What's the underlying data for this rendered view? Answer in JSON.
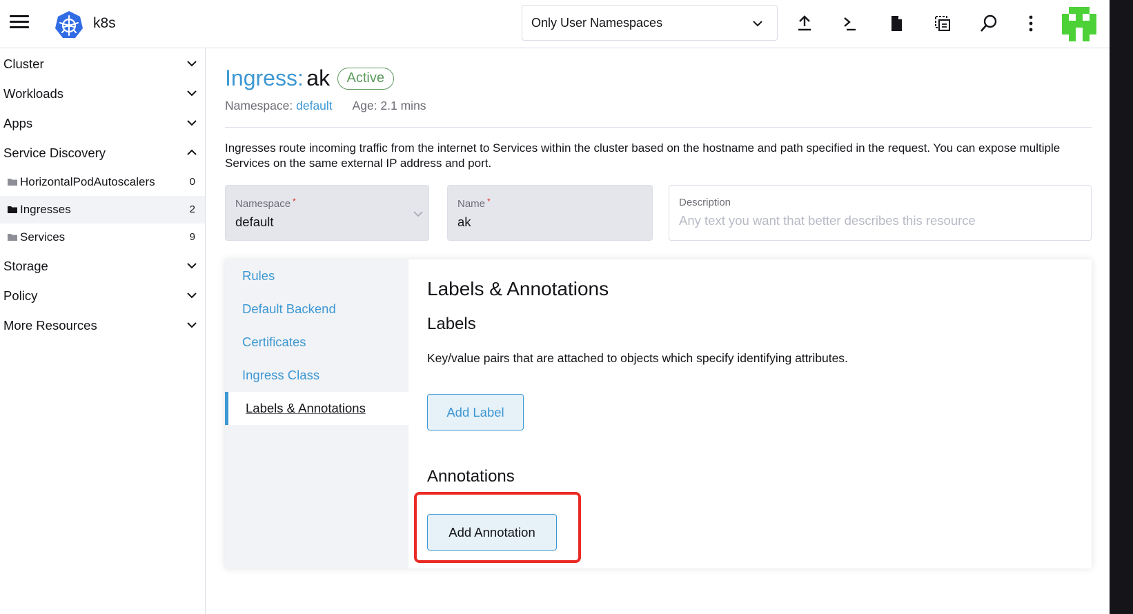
{
  "header": {
    "cluster_name": "k8s",
    "namespace_filter": "Only User Namespaces",
    "icons": [
      "upload-icon",
      "terminal-icon",
      "file-icon",
      "copy-kubeconfig-icon",
      "search-icon",
      "more-vertical-icon"
    ]
  },
  "sidebar": {
    "groups": [
      {
        "label": "Cluster",
        "expanded": false
      },
      {
        "label": "Workloads",
        "expanded": false
      },
      {
        "label": "Apps",
        "expanded": false
      },
      {
        "label": "Service Discovery",
        "expanded": true
      },
      {
        "label": "Storage",
        "expanded": false
      },
      {
        "label": "Policy",
        "expanded": false
      },
      {
        "label": "More Resources",
        "expanded": false
      }
    ],
    "children": [
      {
        "label": "HorizontalPodAutoscalers",
        "count": "0",
        "active": false
      },
      {
        "label": "Ingresses",
        "count": "2",
        "active": true
      },
      {
        "label": "Services",
        "count": "9",
        "active": false
      }
    ]
  },
  "resource": {
    "type_label": "Ingress:",
    "name": "ak",
    "state": "Active",
    "namespace_label": "Namespace:",
    "namespace": "default",
    "age": "Age: 2.1 mins",
    "description": "Ingresses route incoming traffic from the internet to Services within the cluster based on the hostname and path specified in the request. You can expose multiple Services on the same external IP address and port."
  },
  "form": {
    "namespace": {
      "label": "Namespace",
      "required_mark": "*",
      "value": "default"
    },
    "name": {
      "label": "Name",
      "required_mark": "*",
      "value": "ak"
    },
    "description": {
      "label": "Description",
      "placeholder": "Any text you want that better describes this resource"
    }
  },
  "tabs": [
    {
      "label": "Rules",
      "active": false
    },
    {
      "label": "Default Backend",
      "active": false
    },
    {
      "label": "Certificates",
      "active": false
    },
    {
      "label": "Ingress Class",
      "active": false
    },
    {
      "label": "Labels & Annotations",
      "active": true
    }
  ],
  "labels_section": {
    "title": "Labels & Annotations",
    "labels_title": "Labels",
    "labels_desc": "Key/value pairs that are attached to objects which specify identifying attributes.",
    "add_label": "Add Label",
    "annotations_title": "Annotations",
    "add_annotation": "Add Annotation"
  },
  "colors": {
    "accent": "#3d98d3",
    "success": "#5d995d",
    "highlight": "#ea2a25",
    "avatar": "#4cd137"
  }
}
